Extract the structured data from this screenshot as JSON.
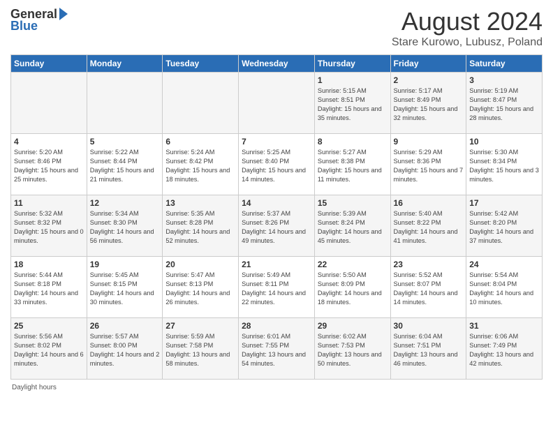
{
  "header": {
    "logo": {
      "general": "General",
      "blue": "Blue"
    },
    "title": "August 2024",
    "location": "Stare Kurowo, Lubusz, Poland"
  },
  "footer": {
    "text": "Daylight hours"
  },
  "days_of_week": [
    "Sunday",
    "Monday",
    "Tuesday",
    "Wednesday",
    "Thursday",
    "Friday",
    "Saturday"
  ],
  "weeks": [
    [
      {
        "day": "",
        "sunrise": "",
        "sunset": "",
        "daylight": ""
      },
      {
        "day": "",
        "sunrise": "",
        "sunset": "",
        "daylight": ""
      },
      {
        "day": "",
        "sunrise": "",
        "sunset": "",
        "daylight": ""
      },
      {
        "day": "",
        "sunrise": "",
        "sunset": "",
        "daylight": ""
      },
      {
        "day": "1",
        "sunrise": "5:15 AM",
        "sunset": "8:51 PM",
        "daylight": "15 hours and 35 minutes."
      },
      {
        "day": "2",
        "sunrise": "5:17 AM",
        "sunset": "8:49 PM",
        "daylight": "15 hours and 32 minutes."
      },
      {
        "day": "3",
        "sunrise": "5:19 AM",
        "sunset": "8:47 PM",
        "daylight": "15 hours and 28 minutes."
      }
    ],
    [
      {
        "day": "4",
        "sunrise": "5:20 AM",
        "sunset": "8:46 PM",
        "daylight": "15 hours and 25 minutes."
      },
      {
        "day": "5",
        "sunrise": "5:22 AM",
        "sunset": "8:44 PM",
        "daylight": "15 hours and 21 minutes."
      },
      {
        "day": "6",
        "sunrise": "5:24 AM",
        "sunset": "8:42 PM",
        "daylight": "15 hours and 18 minutes."
      },
      {
        "day": "7",
        "sunrise": "5:25 AM",
        "sunset": "8:40 PM",
        "daylight": "15 hours and 14 minutes."
      },
      {
        "day": "8",
        "sunrise": "5:27 AM",
        "sunset": "8:38 PM",
        "daylight": "15 hours and 11 minutes."
      },
      {
        "day": "9",
        "sunrise": "5:29 AM",
        "sunset": "8:36 PM",
        "daylight": "15 hours and 7 minutes."
      },
      {
        "day": "10",
        "sunrise": "5:30 AM",
        "sunset": "8:34 PM",
        "daylight": "15 hours and 3 minutes."
      }
    ],
    [
      {
        "day": "11",
        "sunrise": "5:32 AM",
        "sunset": "8:32 PM",
        "daylight": "15 hours and 0 minutes."
      },
      {
        "day": "12",
        "sunrise": "5:34 AM",
        "sunset": "8:30 PM",
        "daylight": "14 hours and 56 minutes."
      },
      {
        "day": "13",
        "sunrise": "5:35 AM",
        "sunset": "8:28 PM",
        "daylight": "14 hours and 52 minutes."
      },
      {
        "day": "14",
        "sunrise": "5:37 AM",
        "sunset": "8:26 PM",
        "daylight": "14 hours and 49 minutes."
      },
      {
        "day": "15",
        "sunrise": "5:39 AM",
        "sunset": "8:24 PM",
        "daylight": "14 hours and 45 minutes."
      },
      {
        "day": "16",
        "sunrise": "5:40 AM",
        "sunset": "8:22 PM",
        "daylight": "14 hours and 41 minutes."
      },
      {
        "day": "17",
        "sunrise": "5:42 AM",
        "sunset": "8:20 PM",
        "daylight": "14 hours and 37 minutes."
      }
    ],
    [
      {
        "day": "18",
        "sunrise": "5:44 AM",
        "sunset": "8:18 PM",
        "daylight": "14 hours and 33 minutes."
      },
      {
        "day": "19",
        "sunrise": "5:45 AM",
        "sunset": "8:15 PM",
        "daylight": "14 hours and 30 minutes."
      },
      {
        "day": "20",
        "sunrise": "5:47 AM",
        "sunset": "8:13 PM",
        "daylight": "14 hours and 26 minutes."
      },
      {
        "day": "21",
        "sunrise": "5:49 AM",
        "sunset": "8:11 PM",
        "daylight": "14 hours and 22 minutes."
      },
      {
        "day": "22",
        "sunrise": "5:50 AM",
        "sunset": "8:09 PM",
        "daylight": "14 hours and 18 minutes."
      },
      {
        "day": "23",
        "sunrise": "5:52 AM",
        "sunset": "8:07 PM",
        "daylight": "14 hours and 14 minutes."
      },
      {
        "day": "24",
        "sunrise": "5:54 AM",
        "sunset": "8:04 PM",
        "daylight": "14 hours and 10 minutes."
      }
    ],
    [
      {
        "day": "25",
        "sunrise": "5:56 AM",
        "sunset": "8:02 PM",
        "daylight": "14 hours and 6 minutes."
      },
      {
        "day": "26",
        "sunrise": "5:57 AM",
        "sunset": "8:00 PM",
        "daylight": "14 hours and 2 minutes."
      },
      {
        "day": "27",
        "sunrise": "5:59 AM",
        "sunset": "7:58 PM",
        "daylight": "13 hours and 58 minutes."
      },
      {
        "day": "28",
        "sunrise": "6:01 AM",
        "sunset": "7:55 PM",
        "daylight": "13 hours and 54 minutes."
      },
      {
        "day": "29",
        "sunrise": "6:02 AM",
        "sunset": "7:53 PM",
        "daylight": "13 hours and 50 minutes."
      },
      {
        "day": "30",
        "sunrise": "6:04 AM",
        "sunset": "7:51 PM",
        "daylight": "13 hours and 46 minutes."
      },
      {
        "day": "31",
        "sunrise": "6:06 AM",
        "sunset": "7:49 PM",
        "daylight": "13 hours and 42 minutes."
      }
    ]
  ]
}
